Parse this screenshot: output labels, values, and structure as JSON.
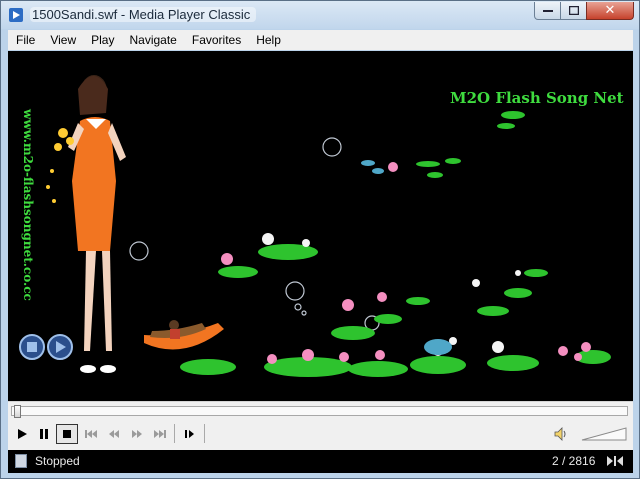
{
  "window": {
    "title": "1500Sandi.swf - Media Player Classic",
    "close_symbol": "✕",
    "minimize_symbol": "▁",
    "maximize_symbol": "☐"
  },
  "menu": {
    "items": [
      "File",
      "View",
      "Play",
      "Navigate",
      "Favorites",
      "Help"
    ]
  },
  "video": {
    "brand_title": "M2O Flash Song Net",
    "vertical_url": "www.m2o-flashsongnet.co.cc",
    "brand_color": "#3fdc3f",
    "lotus_pink": "#f48fc0",
    "dress_color": "#f27521"
  },
  "controls": {
    "play_icon": "play-icon",
    "pause_icon": "pause-icon",
    "stop_icon": "stop-icon",
    "skip_back_icon": "skip-back-icon",
    "rewind_icon": "rewind-icon",
    "fast_forward_icon": "fast-forward-icon",
    "skip_forward_icon": "skip-forward-icon",
    "frame_step_icon": "frame-step-icon",
    "seek_fraction": 0.0007
  },
  "status": {
    "state": "Stopped",
    "position": "2 / 2816"
  }
}
